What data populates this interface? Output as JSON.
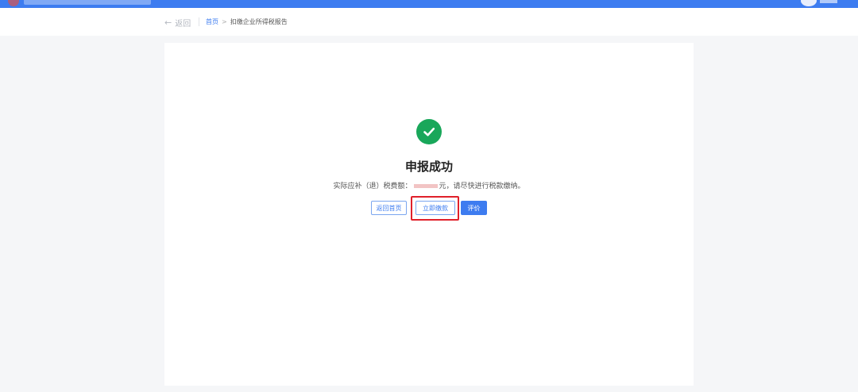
{
  "header": {
    "logo_icon": "emblem-icon",
    "avatar_icon": "user-avatar-icon",
    "bar_color": "#3d7cf0"
  },
  "breadcrumb": {
    "back_label": "返回",
    "back_icon": "arrow-left-icon",
    "home": "首页",
    "separator": ">",
    "current": "扣缴企业所得税报告"
  },
  "result": {
    "icon": "check-circle-icon",
    "icon_color": "#19a75a",
    "title": "申报成功",
    "message_prefix": "实际应补（退）税费额：",
    "message_suffix": "元，请尽快进行税款缴纳。"
  },
  "actions": {
    "return_home": "返回首页",
    "pay_now": "立即缴款",
    "rate": "评价"
  }
}
